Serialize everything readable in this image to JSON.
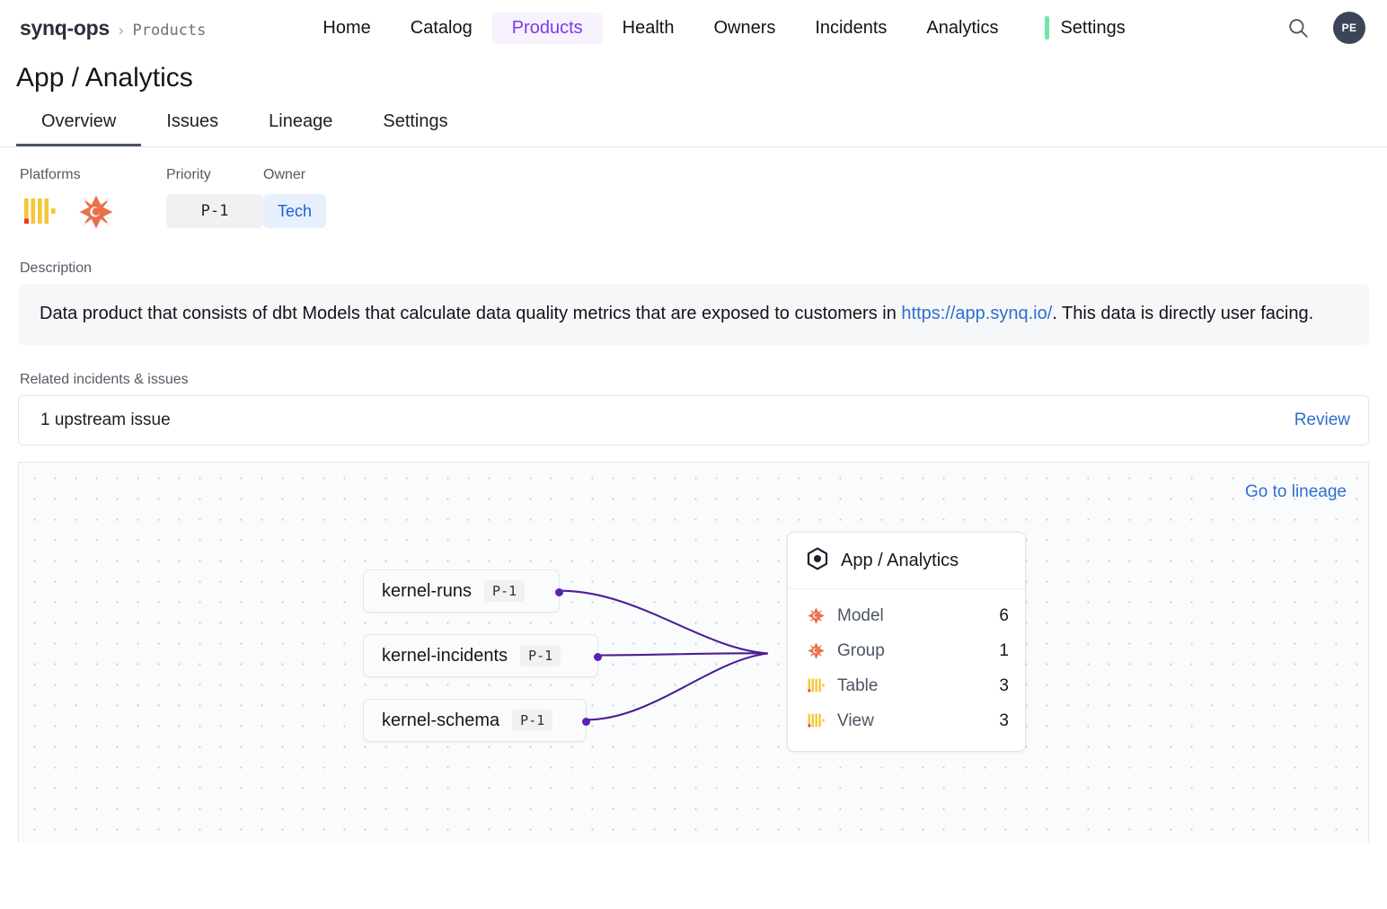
{
  "topnav": {
    "brand": "synq-ops",
    "crumb_separator": "›",
    "crumb": "Products",
    "links": [
      {
        "label": "Home",
        "active": false
      },
      {
        "label": "Catalog",
        "active": false
      },
      {
        "label": "Products",
        "active": true
      },
      {
        "label": "Health",
        "active": false
      },
      {
        "label": "Owners",
        "active": false
      },
      {
        "label": "Incidents",
        "active": false
      },
      {
        "label": "Analytics",
        "active": false
      }
    ],
    "settings_label": "Settings",
    "settings_marker_color": "#6ee7a8",
    "search_icon": "search-icon",
    "avatar_initials": "PE",
    "accent_color": "#7c3aed"
  },
  "header": {
    "title": "App / Analytics",
    "tabs": [
      {
        "label": "Overview",
        "active": true
      },
      {
        "label": "Issues",
        "active": false
      },
      {
        "label": "Lineage",
        "active": false
      },
      {
        "label": "Settings",
        "active": false
      }
    ]
  },
  "meta": {
    "platforms_label": "Platforms",
    "platform_icons": [
      "bigquery-icon",
      "dbt-icon"
    ],
    "priority_label": "Priority",
    "priority_value": "P-1",
    "owner_label": "Owner",
    "owner_value": "Tech"
  },
  "description": {
    "label": "Description",
    "text_before": "Data product that consists of dbt Models that calculate data quality metrics that are exposed to customers in ",
    "link_text": "https://app.synq.io/",
    "text_after": ". This data is directly user facing."
  },
  "related": {
    "label": "Related incidents & issues",
    "summary": "1 upstream issue",
    "action_label": "Review"
  },
  "lineage": {
    "go_to_lineage_label": "Go to lineage",
    "edge_color": "#4c1d95",
    "upstream_nodes": [
      {
        "name": "kernel-runs",
        "priority": "P-1"
      },
      {
        "name": "kernel-incidents",
        "priority": "P-1"
      },
      {
        "name": "kernel-schema",
        "priority": "P-1"
      }
    ],
    "product_card": {
      "icon": "hexagon-product-icon",
      "title": "App / Analytics",
      "rows": [
        {
          "icon": "dbt-icon",
          "label": "Model",
          "count": "6"
        },
        {
          "icon": "dbt-icon",
          "label": "Group",
          "count": "1"
        },
        {
          "icon": "bigquery-icon",
          "label": "Table",
          "count": "3"
        },
        {
          "icon": "bigquery-icon",
          "label": "View",
          "count": "3"
        }
      ]
    }
  }
}
